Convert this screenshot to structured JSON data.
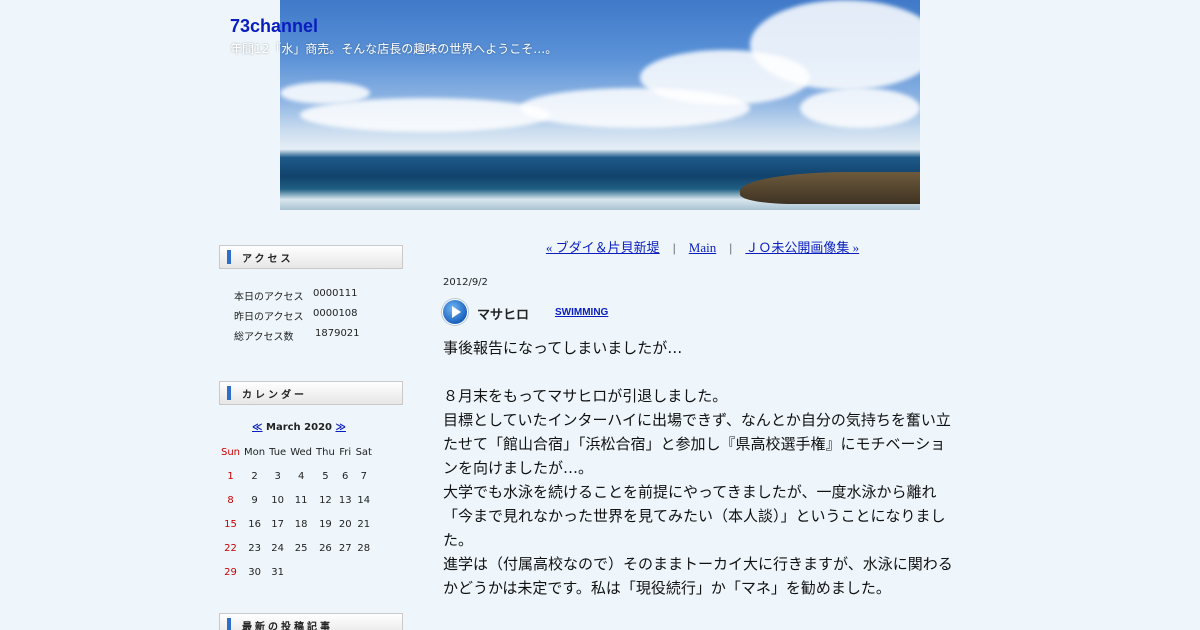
{
  "header": {
    "site_title": "73channel",
    "tagline": "年間12「水」商売。そんな店長の趣味の世界へようこそ…。"
  },
  "sidebar": {
    "access": {
      "title": "アクセス",
      "rows": [
        {
          "label": "本日のアクセス",
          "value": "0000111"
        },
        {
          "label": "昨日のアクセス",
          "value": "0000108"
        },
        {
          "label": "総アクセス数",
          "value": "1879021"
        }
      ]
    },
    "calendar": {
      "title": "カレンダー",
      "prev": "≪",
      "month": "March 2020",
      "next": "≫",
      "weekdays": [
        "Sun",
        "Mon",
        "Tue",
        "Wed",
        "Thu",
        "Fri",
        "Sat"
      ],
      "weeks": [
        [
          "1",
          "2",
          "3",
          "4",
          "5",
          "6",
          "7"
        ],
        [
          "8",
          "9",
          "10",
          "11",
          "12",
          "13",
          "14"
        ],
        [
          "15",
          "16",
          "17",
          "18",
          "19",
          "20",
          "21"
        ],
        [
          "22",
          "23",
          "24",
          "25",
          "26",
          "27",
          "28"
        ],
        [
          "29",
          "30",
          "31",
          "",
          "",
          "",
          ""
        ]
      ]
    },
    "recent": {
      "title": "最新の投稿記事"
    }
  },
  "main": {
    "nav": {
      "prev": "« ブダイ＆片貝新堤",
      "sep": "|",
      "home": "Main",
      "next": "ＪＯ未公開画像集 »"
    },
    "post": {
      "date": "2012/9/2",
      "title": "マサヒロ",
      "category": "SWIMMING",
      "paragraphs": [
        "事後報告になってしまいましたが…",
        "",
        "８月末をもってマサヒロが引退しました。",
        "目標としていたインターハイに出場できず、なんとか自分の気持ちを奮い立たせて「館山合宿」「浜松合宿」と参加し『県高校選手権』にモチベーションを向けましたが…。",
        "大学でも水泳を続けることを前提にやってきましたが、一度水泳から離れ「今まで見れなかった世界を見てみたい（本人談）」ということになりました。",
        "進学は（付属高校なので）そのままトーカイ大に行きますが、水泳に関わるかどうかは未定です。私は「現役続行」か「マネ」を勧めました。"
      ]
    }
  },
  "colors": {
    "background": "#eef6fb",
    "link": "#0a1dbf",
    "sunday": "#cc0000",
    "widget_bar": "#2d6fc7"
  }
}
